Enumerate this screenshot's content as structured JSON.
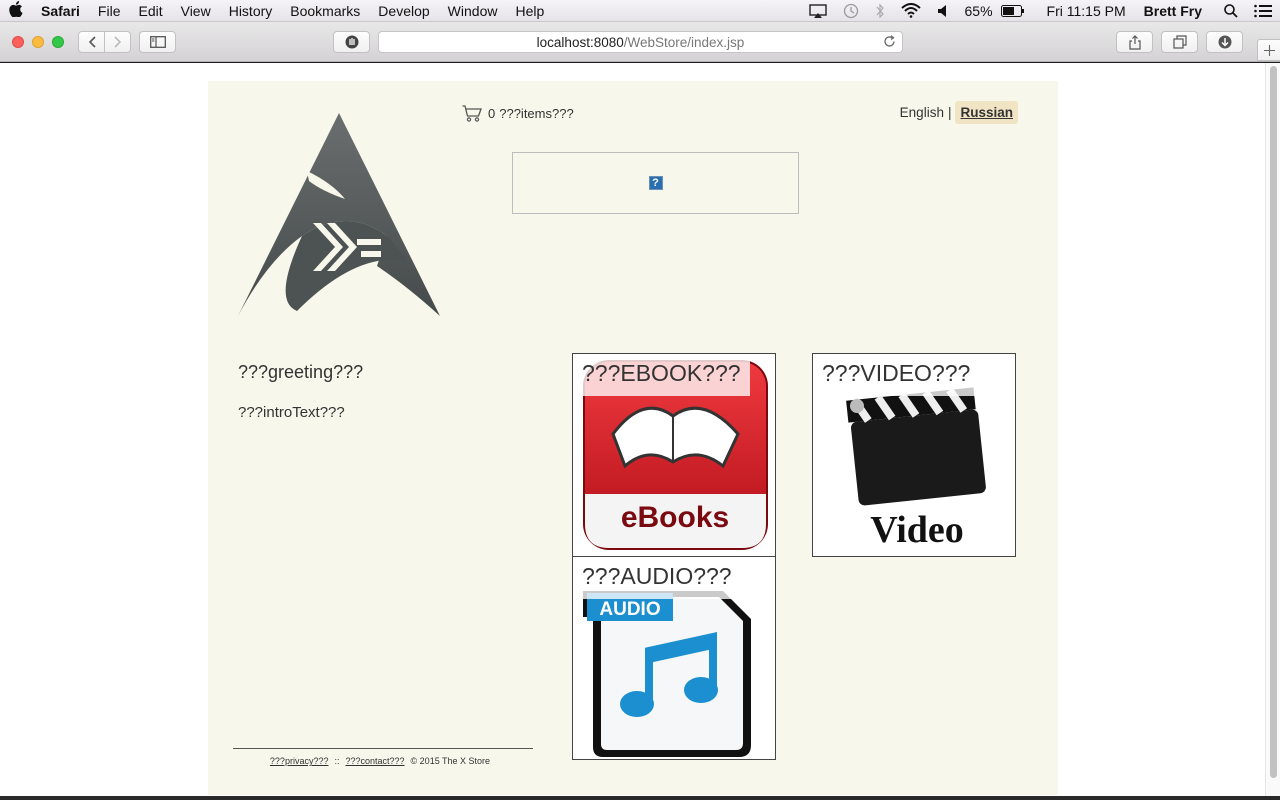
{
  "menubar": {
    "app": "Safari",
    "items": [
      "File",
      "Edit",
      "View",
      "History",
      "Bookmarks",
      "Develop",
      "Window",
      "Help"
    ],
    "battery": "65%",
    "clock": "Fri 11:15 PM",
    "user": "Brett Fry"
  },
  "toolbar": {
    "url_host": "localhost:8080",
    "url_path": "/WebStore/index.jsp"
  },
  "page": {
    "cart_count": "0",
    "cart_label": "???items???",
    "lang_english": "English",
    "lang_separator": "|",
    "lang_russian": "Russian",
    "greeting": "???greeting???",
    "intro": "???introText???",
    "tiles": {
      "ebook": {
        "caption": "???EBOOK???",
        "image_text": "eBooks"
      },
      "video": {
        "caption": "???VIDEO???",
        "image_text": "Video"
      },
      "audio": {
        "caption": "???AUDIO???",
        "image_text": "AUDIO"
      }
    },
    "footer": {
      "privacy": "???privacy???",
      "separator": "::",
      "contact": "???contact???",
      "copyright": "© 2015 The X Store"
    }
  },
  "colors": {
    "page_bg": "#f7f7eb",
    "active_lang_bg": "#f0e4c4",
    "ebook_red": "#c8141e",
    "audio_blue": "#1b8fd0"
  },
  "icons": [
    "apple-icon",
    "airplay-icon",
    "time-machine-icon",
    "bluetooth-icon",
    "wifi-icon",
    "volume-icon",
    "battery-icon",
    "spotlight-icon",
    "notification-center-icon",
    "back-icon",
    "forward-icon",
    "sidebar-icon",
    "privacy-shield-icon",
    "reload-icon",
    "share-icon",
    "tabs-icon",
    "download-icon",
    "new-tab-icon",
    "cart-icon",
    "broken-image-icon"
  ]
}
